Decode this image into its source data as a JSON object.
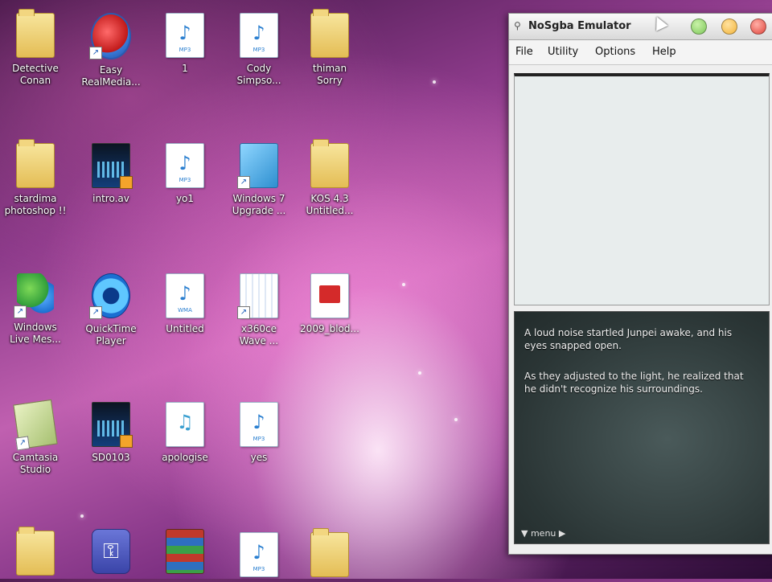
{
  "desktop": {
    "icons": [
      {
        "label": "Detective\nConan",
        "kind": "folder-icon"
      },
      {
        "label": "Easy\nRealMedia...",
        "kind": "realmedia-icon"
      },
      {
        "label": "1",
        "kind": "mp3-file-icon"
      },
      {
        "label": "Cody\nSimpso...",
        "kind": "mp3-file-icon"
      },
      {
        "label": "thiman\nSorry",
        "kind": "folder-icon"
      },
      {
        "label": "stardima\nphotoshop !!",
        "kind": "folder-icon"
      },
      {
        "label": "intro.av",
        "kind": "video-file-icon"
      },
      {
        "label": "yo1",
        "kind": "mp3-file-icon"
      },
      {
        "label": "Windows 7\nUpgrade ...",
        "kind": "installer-icon"
      },
      {
        "label": "KOS 4.3\nUntitled...",
        "kind": "folder-icon"
      },
      {
        "label": "Windows\nLive Mes...",
        "kind": "messenger-icon"
      },
      {
        "label": "QuickTime\nPlayer",
        "kind": "quicktime-icon"
      },
      {
        "label": "Untitled",
        "kind": "wma-file-icon"
      },
      {
        "label": "x360ce\nWave ...",
        "kind": "document-icon"
      },
      {
        "label": "2009_blod...",
        "kind": "pdf-file-icon"
      },
      {
        "label": "Camtasia\nStudio",
        "kind": "camtasia-icon"
      },
      {
        "label": "SD0103",
        "kind": "video-file-icon"
      },
      {
        "label": "apologise",
        "kind": "audio-file-icon"
      },
      {
        "label": "yes",
        "kind": "mp3-file-icon"
      },
      {
        "label": "",
        "kind": "blank"
      },
      {
        "label": "",
        "kind": "folder-icon"
      },
      {
        "label": "",
        "kind": "key-app-icon"
      },
      {
        "label": "",
        "kind": "winrar-icon"
      },
      {
        "label": "",
        "kind": "mp3-file-icon"
      },
      {
        "label": "",
        "kind": "folder-icon"
      }
    ],
    "mp3_tag": "MP3",
    "wma_tag": "WMA"
  },
  "emulator": {
    "title": "NoSgba Emulator",
    "menus": [
      "File",
      "Utility",
      "Options",
      "Help"
    ],
    "dialog_line1": "A loud noise startled Junpei awake, and his eyes snapped open.",
    "dialog_line2": "As they adjusted to the light, he realized that he didn't recognize his surroundings.",
    "menu_hint": "▼ menu ▶",
    "controls": {
      "minimize": "#7ec85a",
      "maximize": "#f3b43a",
      "close": "#e0443a"
    }
  }
}
